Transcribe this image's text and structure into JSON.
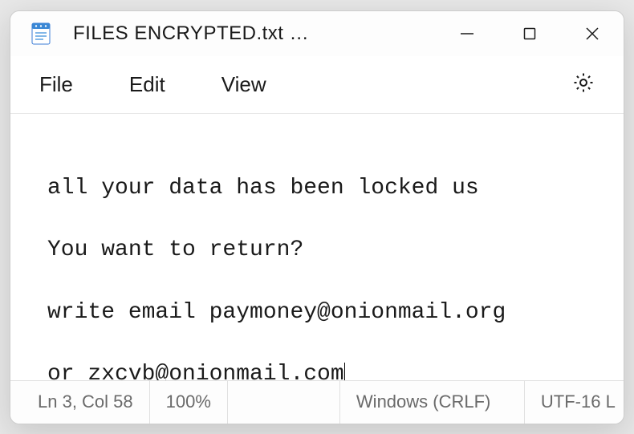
{
  "titlebar": {
    "title": "FILES ENCRYPTED.txt …"
  },
  "menubar": {
    "file": "File",
    "edit": "Edit",
    "view": "View"
  },
  "content": {
    "line1": "all your data has been locked us",
    "line2": "You want to return?",
    "line3": "write email paymoney@onionmail.org",
    "line4": "or zxcvb@onionmail.com"
  },
  "statusbar": {
    "position": "Ln 3, Col 58",
    "zoom": "100%",
    "eol": "Windows (CRLF)",
    "encoding": "UTF-16 L"
  }
}
